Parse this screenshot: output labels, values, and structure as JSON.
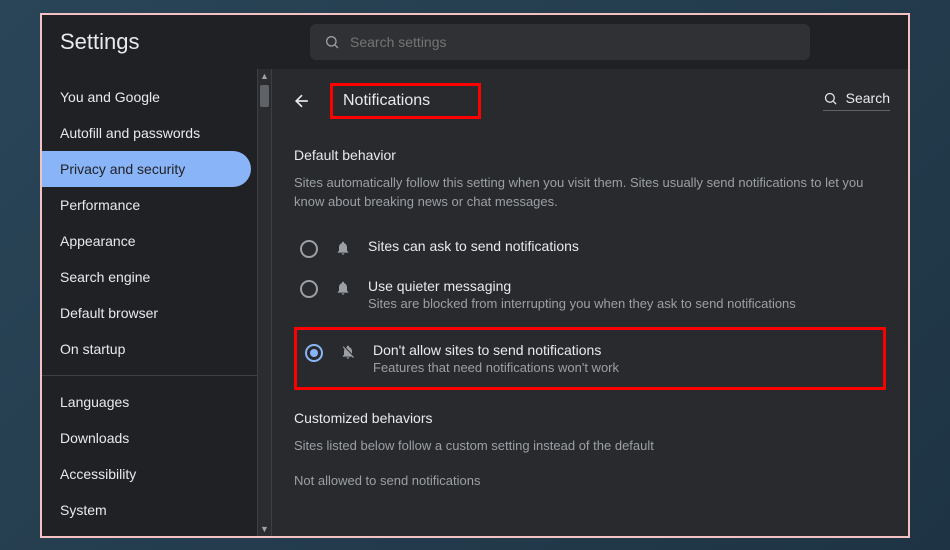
{
  "header": {
    "title": "Settings",
    "search_placeholder": "Search settings"
  },
  "sidebar": {
    "items": [
      {
        "label": "You and Google",
        "active": false
      },
      {
        "label": "Autofill and passwords",
        "active": false
      },
      {
        "label": "Privacy and security",
        "active": true
      },
      {
        "label": "Performance",
        "active": false
      },
      {
        "label": "Appearance",
        "active": false
      },
      {
        "label": "Search engine",
        "active": false
      },
      {
        "label": "Default browser",
        "active": false
      },
      {
        "label": "On startup",
        "active": false
      }
    ],
    "items2": [
      {
        "label": "Languages"
      },
      {
        "label": "Downloads"
      },
      {
        "label": "Accessibility"
      },
      {
        "label": "System"
      }
    ]
  },
  "content": {
    "page_title": "Notifications",
    "search_label": "Search",
    "default_behavior": {
      "title": "Default behavior",
      "desc": "Sites automatically follow this setting when you visit them. Sites usually send notifications to let you know about breaking news or chat messages."
    },
    "options": [
      {
        "label": "Sites can ask to send notifications",
        "sub": "",
        "selected": false,
        "icon": "bell"
      },
      {
        "label": "Use quieter messaging",
        "sub": "Sites are blocked from interrupting you when they ask to send notifications",
        "selected": false,
        "icon": "bell"
      },
      {
        "label": "Don't allow sites to send notifications",
        "sub": "Features that need notifications won't work",
        "selected": true,
        "icon": "bell-off"
      }
    ],
    "customized": {
      "title": "Customized behaviors",
      "desc": "Sites listed below follow a custom setting instead of the default",
      "not_allowed": "Not allowed to send notifications"
    }
  }
}
